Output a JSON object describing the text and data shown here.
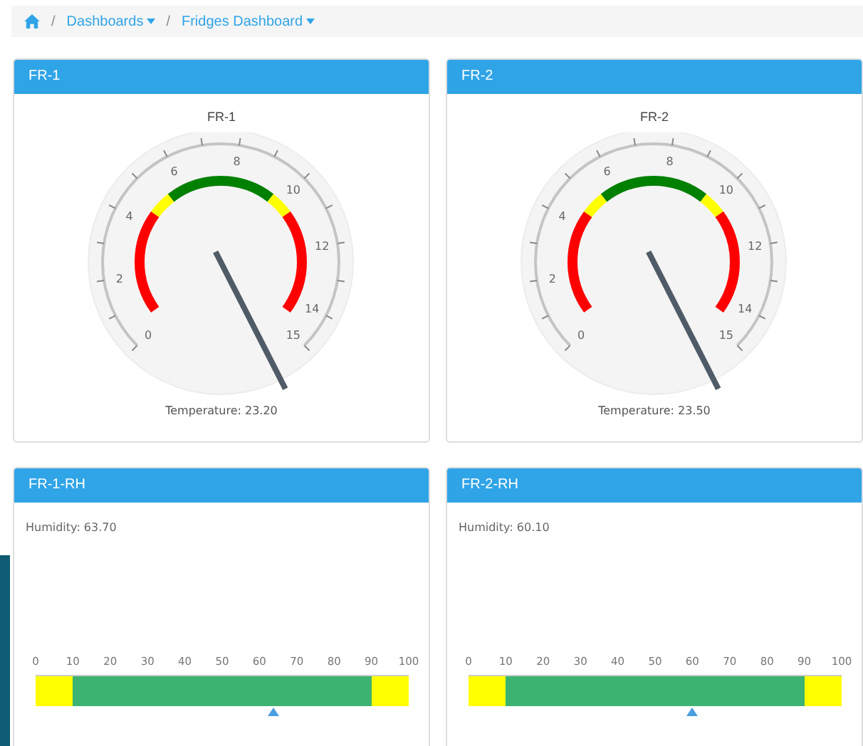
{
  "breadcrumb": [
    {
      "separator": "/",
      "label": "Dashboards",
      "kind": "dropdown"
    },
    {
      "separator": "/",
      "label": "Fridges Dashboard",
      "kind": "dropdown"
    }
  ],
  "gauges": [
    {
      "title": "FR-1",
      "chart_title": "FR-1",
      "ticks": [
        "0",
        "2",
        "4",
        "6",
        "8",
        "10",
        "12",
        "14",
        "15"
      ],
      "reading": "Temperature: 23.20"
    },
    {
      "title": "FR-2",
      "chart_title": "FR-2",
      "ticks": [
        "0",
        "2",
        "4",
        "6",
        "8",
        "10",
        "12",
        "14",
        "15"
      ],
      "reading": "Temperature: 23.50"
    }
  ],
  "humidity": [
    {
      "title": "FR-1-RH",
      "reading": "Humidity: 63.70",
      "ticks": [
        "0",
        "10",
        "20",
        "30",
        "40",
        "50",
        "60",
        "70",
        "80",
        "90",
        "100"
      ],
      "level": 0.637
    },
    {
      "title": "FR-2-RH",
      "reading": "Humidity: 60.10",
      "ticks": [
        "0",
        "10",
        "20",
        "30",
        "40",
        "50",
        "60",
        "70",
        "80",
        "90",
        "100"
      ],
      "level": 0.601
    }
  ]
}
